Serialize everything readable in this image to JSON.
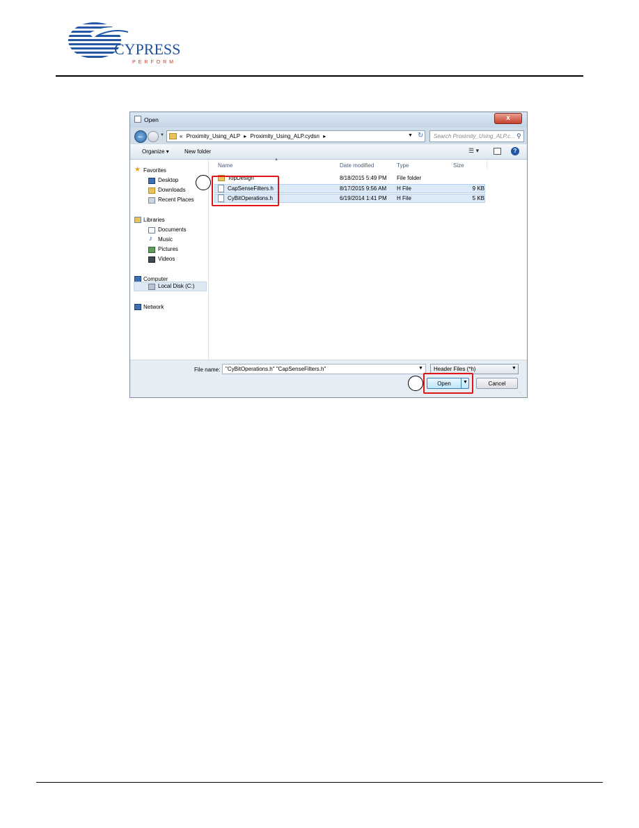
{
  "logo": {
    "brand": "CYPRESS",
    "tagline": "PERFORM"
  },
  "dialog": {
    "title": "Open",
    "close_glyph": "x",
    "address_path": [
      "«",
      "Proximity_Using_ALP",
      "▸",
      "Proximity_Using_ALP.cydsn",
      "▸"
    ],
    "search_placeholder": "Search Proximity_Using_ALP.c...",
    "toolbar": {
      "organize": "Organize ▾",
      "new_folder": "New folder"
    },
    "nav": {
      "favorites": "Favorites",
      "desktop": "Desktop",
      "downloads": "Downloads",
      "recent_places": "Recent Places",
      "libraries": "Libraries",
      "documents": "Documents",
      "music": "Music",
      "pictures": "Pictures",
      "videos": "Videos",
      "computer": "Computer",
      "local_disk": "Local Disk (C:)",
      "network": "Network"
    },
    "columns": {
      "name": "Name",
      "date": "Date modified",
      "type": "Type",
      "size": "Size"
    },
    "files": [
      {
        "name": "TopDesign",
        "date": "8/18/2015 5:49 PM",
        "type": "File folder",
        "size": ""
      },
      {
        "name": "CapSenseFilters.h",
        "date": "8/17/2015 9:56 AM",
        "type": "H File",
        "size": "9 KB"
      },
      {
        "name": "CyBitOperations.h",
        "date": "6/19/2014 1:41 PM",
        "type": "H File",
        "size": "5 KB"
      }
    ],
    "file_name_label": "File name:",
    "file_name_value": "\"CyBitOperations.h\" \"CapSenseFilters.h\"",
    "filter_value": "Header Files (*h)",
    "open_label": "Open",
    "cancel_label": "Cancel"
  },
  "colors": {
    "callout": "#e0151a",
    "dialog_bg": "#cfdde9",
    "selection": "#dce9f7"
  }
}
